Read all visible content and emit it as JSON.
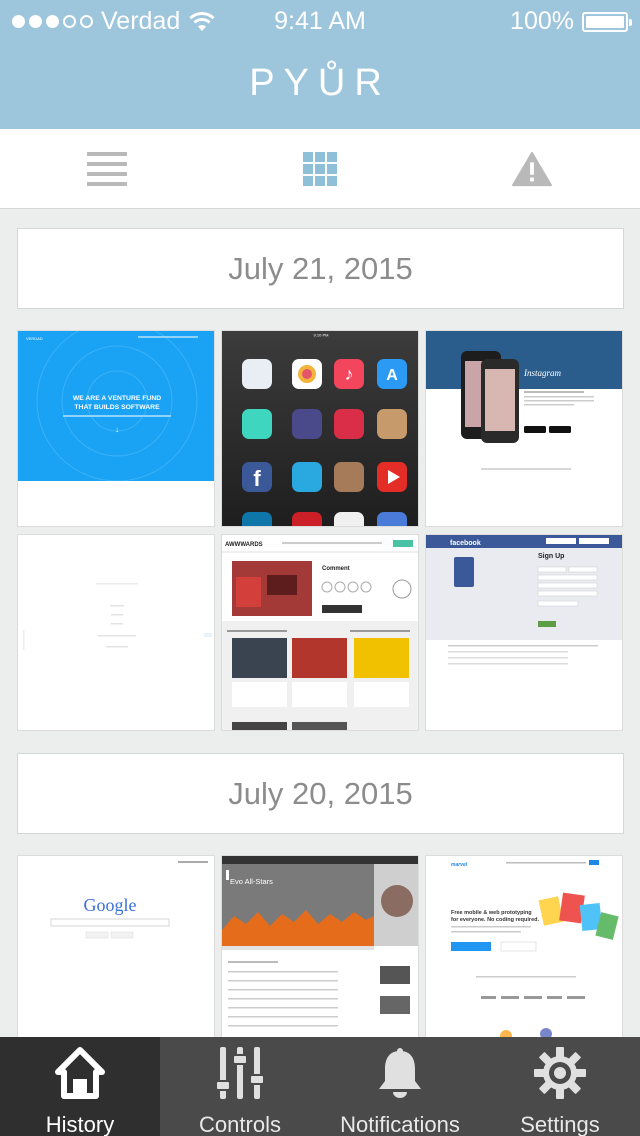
{
  "status_bar": {
    "carrier": "Verdad",
    "time": "9:41 AM",
    "battery": "100%",
    "signal_bars_filled": 3,
    "signal_bars_total": 5
  },
  "app": {
    "brand": "PYŮR",
    "accent_color": "#9dc5dc"
  },
  "toolbar": {
    "items": [
      {
        "icon": "list-icon"
      },
      {
        "icon": "grid-icon"
      },
      {
        "icon": "alert-icon"
      }
    ]
  },
  "history": [
    {
      "date": "July 21, 2015",
      "thumbnails": [
        {
          "site": "verdad",
          "hero_text": "WE ARE A VENTURE FUND THAT BUILDS SOFTWARE",
          "logo": "VERDAD"
        },
        {
          "site": "ipad-home",
          "clock": "9:10 PM",
          "apps": [
            "Tweetbot",
            "Photos",
            "Music",
            "App Store",
            "Nuzzel",
            "Vectors",
            "Wunder",
            "Readlist",
            "Facebook",
            "Twitter",
            "Instagram",
            "YouTube"
          ]
        },
        {
          "site": "instagram",
          "logo": "Instagram"
        },
        {
          "site": "blank-form",
          "text": ""
        },
        {
          "site": "awwwards",
          "logo": "AWWWARDS",
          "title": "Comment"
        },
        {
          "site": "facebook",
          "logo": "facebook",
          "heading": "Sign Up",
          "button": "Sign Up"
        }
      ]
    },
    {
      "date": "July 20, 2015",
      "thumbnails": [
        {
          "site": "google",
          "logo": "Google"
        },
        {
          "site": "soundcloud",
          "title": "Evo All-Stars"
        },
        {
          "site": "marvel",
          "headline": "Free mobile & web prototyping for everyone. No coding required."
        }
      ]
    }
  ],
  "tabs": [
    {
      "label": "History",
      "icon": "house-icon",
      "active": true
    },
    {
      "label": "Controls",
      "icon": "sliders-icon",
      "active": false
    },
    {
      "label": "Notifications",
      "icon": "bell-icon",
      "active": false
    },
    {
      "label": "Settings",
      "icon": "gear-icon",
      "active": false
    }
  ]
}
